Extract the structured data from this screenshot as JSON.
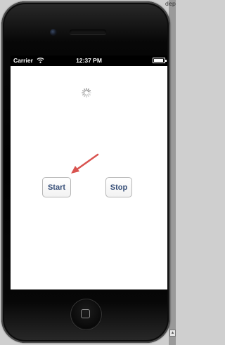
{
  "status_bar": {
    "carrier": "Carrier",
    "time": "12:37 PM",
    "battery_level": 0.9
  },
  "window": {
    "corner_text": "dep"
  },
  "buttons": {
    "start_label": "Start",
    "stop_label": "Stop"
  },
  "icons": {
    "wifi": "wifi-icon",
    "battery": "battery-icon",
    "spinner": "activity-indicator-icon",
    "arrow": "arrow-annotation-icon",
    "home": "home-button-icon"
  },
  "colors": {
    "arrow": "#d9534f",
    "button_text": "#364e78",
    "status_bar": "#000000"
  }
}
